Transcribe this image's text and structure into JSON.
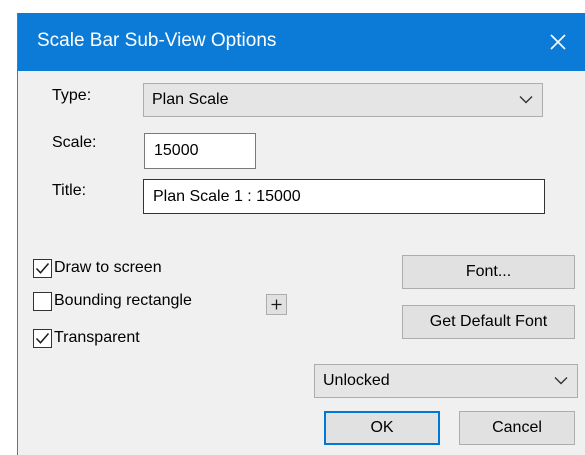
{
  "window": {
    "title": "Scale Bar Sub-View Options",
    "close_icon": "close-icon"
  },
  "type": {
    "label": "Type:",
    "selected": "Plan Scale"
  },
  "scale": {
    "label": "Scale:",
    "value": "15000"
  },
  "title_field": {
    "label": "Title:",
    "value": "Plan Scale 1 : 15000"
  },
  "options": {
    "draw_to_screen": {
      "label": "Draw to screen",
      "checked": true
    },
    "bounding_rectangle": {
      "label": "Bounding rectangle",
      "checked": false
    },
    "transparent": {
      "label": "Transparent",
      "checked": true
    },
    "bounding_plus_icon": "plus-icon"
  },
  "buttons": {
    "font": "Font...",
    "get_default_font": "Get Default Font",
    "ok": "OK",
    "cancel": "Cancel"
  },
  "lock": {
    "selected": "Unlocked"
  },
  "colors": {
    "title_bar": "#0b7bd7",
    "dialog_bg": "#f0f0f0",
    "default_button_border": "#0078d7"
  }
}
